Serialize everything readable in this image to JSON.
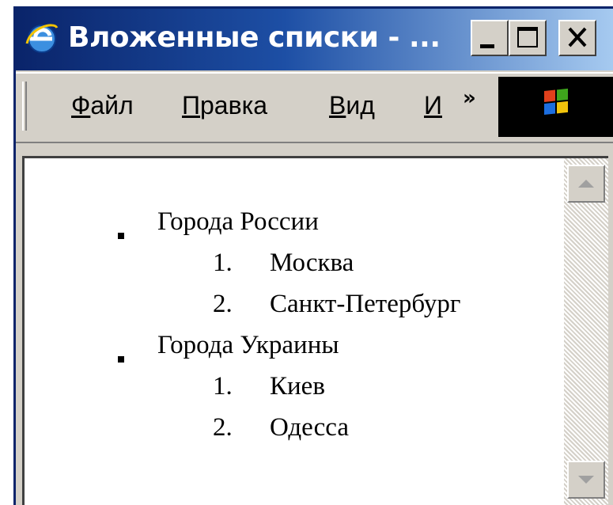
{
  "window": {
    "title": "Вложенные списки - ...",
    "icon": "internet-explorer-icon"
  },
  "menu": {
    "items": [
      {
        "accel": "Ф",
        "rest": "айл"
      },
      {
        "accel": "П",
        "rest": "равка"
      },
      {
        "accel": "В",
        "rest": "ид"
      },
      {
        "accel": "И",
        "rest": ""
      }
    ],
    "overflow": "»"
  },
  "content": {
    "lists": [
      {
        "label": "Города России",
        "items": [
          {
            "num": "1.",
            "text": "Москва"
          },
          {
            "num": "2.",
            "text": "Санкт-Петербург"
          }
        ]
      },
      {
        "label": "Города Украины",
        "items": [
          {
            "num": "1.",
            "text": "Киев"
          },
          {
            "num": "2.",
            "text": "Одесса"
          }
        ]
      }
    ]
  },
  "colors": {
    "titlebar_start": "#0a246a",
    "titlebar_end": "#a6caf0",
    "chrome": "#d4d0c8"
  }
}
